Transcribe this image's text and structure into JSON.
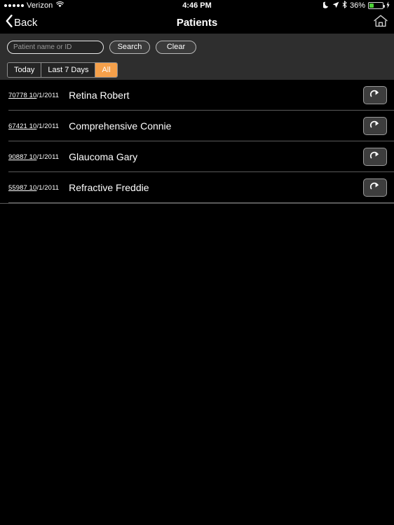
{
  "status_bar": {
    "signal_dots": 5,
    "carrier": "Verizon",
    "wifi_icon": "wifi-icon",
    "time": "4:46 PM",
    "dnd_icon": "moon-icon",
    "location_icon": "location-arrow-icon",
    "bluetooth_icon": "bluetooth-icon",
    "battery_percent": "36%",
    "battery_level": 36,
    "battery_color": "#4cd137",
    "charging_icon": "lightning-bolt-icon"
  },
  "nav_bar": {
    "back_label": "Back",
    "back_icon": "chevron-left-icon",
    "title": "Patients",
    "home_icon": "home-icon"
  },
  "toolbar": {
    "search_placeholder": "Patient name or ID",
    "search_value": "",
    "search_button": "Search",
    "clear_button": "Clear",
    "filters": [
      {
        "label": "Today",
        "active": false
      },
      {
        "label": "Last 7 Days",
        "active": false
      },
      {
        "label": "All",
        "active": true
      }
    ],
    "active_color": "#f5a04a"
  },
  "patients": [
    {
      "id": "70778 10",
      "date_tail": "/1/2011",
      "name": "Retina Robert",
      "action_icon": "curved-arrow-right-icon"
    },
    {
      "id": "67421 10",
      "date_tail": "/1/2011",
      "name": "Comprehensive Connie",
      "action_icon": "curved-arrow-right-icon"
    },
    {
      "id": "90887 10",
      "date_tail": "/1/2011",
      "name": "Glaucoma Gary",
      "action_icon": "curved-arrow-right-icon"
    },
    {
      "id": "55987 10",
      "date_tail": "/1/2011",
      "name": "Refractive Freddie",
      "action_icon": "curved-arrow-right-icon"
    }
  ]
}
